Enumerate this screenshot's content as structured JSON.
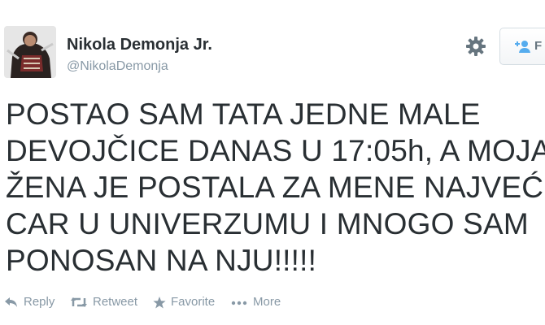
{
  "author": {
    "name": "Nikola Demonja Jr.",
    "handle": "@NikolaDemonja"
  },
  "follow_button": {
    "label": "F",
    "icon": "add-person-icon"
  },
  "settings": {
    "icon": "gear-icon"
  },
  "tweet": {
    "text": "POSTAO SAM TATA JEDNE MALE\nDEVOJČICE DANAS U 17:05h, A MOJA\nŽENA JE POSTALA ZA MENE NAJVEĆI\nCAR U UNIVERZUMU I MNOGO SAM\nPONOSAN NA NJU!!!!!"
  },
  "actions": {
    "reply": {
      "label": "Reply",
      "icon": "reply-icon"
    },
    "retweet": {
      "label": "Retweet",
      "icon": "retweet-icon"
    },
    "favorite": {
      "label": "Favorite",
      "icon": "star-icon"
    },
    "more": {
      "label": "More",
      "icon": "ellipsis-icon"
    }
  },
  "colors": {
    "text": "#292f33",
    "muted": "#8899a6",
    "icon": "#66757f"
  }
}
